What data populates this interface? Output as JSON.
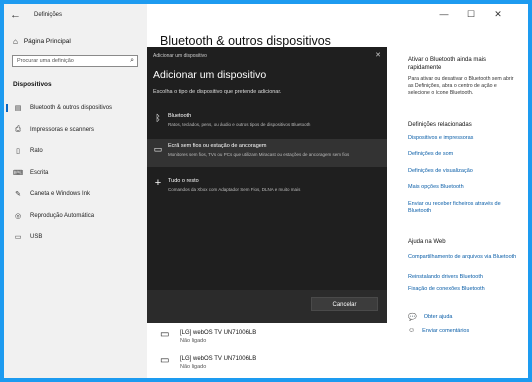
{
  "window": {
    "title": "Definições",
    "back_icon": "←",
    "min_icon": "—",
    "max_icon": "☐",
    "close_icon": "✕"
  },
  "sidebar": {
    "home_label": "Página Principal",
    "search_placeholder": "Procurar uma definição",
    "section_title": "Dispositivos",
    "items": [
      {
        "label": "Bluetooth & outros dispositivos",
        "icon": "bluetooth-icon",
        "active": true
      },
      {
        "label": "Impressoras e scanners",
        "icon": "printer-icon"
      },
      {
        "label": "Rato",
        "icon": "mouse-icon"
      },
      {
        "label": "Escrita",
        "icon": "keyboard-icon"
      },
      {
        "label": "Caneta e Windows Ink",
        "icon": "pen-icon"
      },
      {
        "label": "Reprodução Automática",
        "icon": "autoplay-icon"
      },
      {
        "label": "USB",
        "icon": "usb-icon"
      }
    ]
  },
  "main": {
    "title": "Bluetooth & outros dispositivos",
    "devices": [
      {
        "name": "[LG] webOS TV UN71006LB",
        "status": "Não ligado"
      },
      {
        "name": "[LG] webOS TV UN71006LB",
        "status": "Não ligado"
      }
    ]
  },
  "right_panel": {
    "quick_title": "Ativar o Bluetooth ainda mais rapidamente",
    "quick_text": "Para ativar ou desativar o Bluetooth sem abrir as Definições, abra o centro de ação e selecione o ícone Bluetooth.",
    "related_title": "Definições relacionadas",
    "related_links": [
      "Dispositivos e impressoras",
      "Definições de som",
      "Definições de visualização",
      "Mais opções Bluetooth",
      "Enviar ou receber ficheiros através de Bluetooth"
    ],
    "help_title": "Ajuda na Web",
    "help_links": [
      "Compartilhamento de arquivos via Bluetooth",
      "Reinstalando drivers Bluetooth",
      "Fixação de conexões Bluetooth"
    ],
    "get_help": "Obter ajuda",
    "send_feedback": "Enviar comentários"
  },
  "dialog": {
    "header": "Adicionar um dispositivo",
    "title": "Adicionar um dispositivo",
    "subtitle": "Escolha o tipo de dispositivo que pretende adicionar.",
    "options": [
      {
        "title": "Bluetooth",
        "desc": "Ratos, teclados, pens, ou áudio e outros tipos de dispositivos Bluetooth",
        "icon": "bluetooth-icon"
      },
      {
        "title": "Ecrã sem fios ou estação de ancoragem",
        "desc": "Monitores sem fios, TVs ou PCs que utilizam Miracast ou estações de ancoragem sem fios",
        "icon": "monitor-icon",
        "selected": true
      },
      {
        "title": "Tudo o resto",
        "desc": "Comandos da Xbox com Adaptador Sem Fios, DLNA e muito mais",
        "icon": "plus-icon"
      }
    ],
    "cancel_label": "Cancelar",
    "close_icon": "✕"
  }
}
